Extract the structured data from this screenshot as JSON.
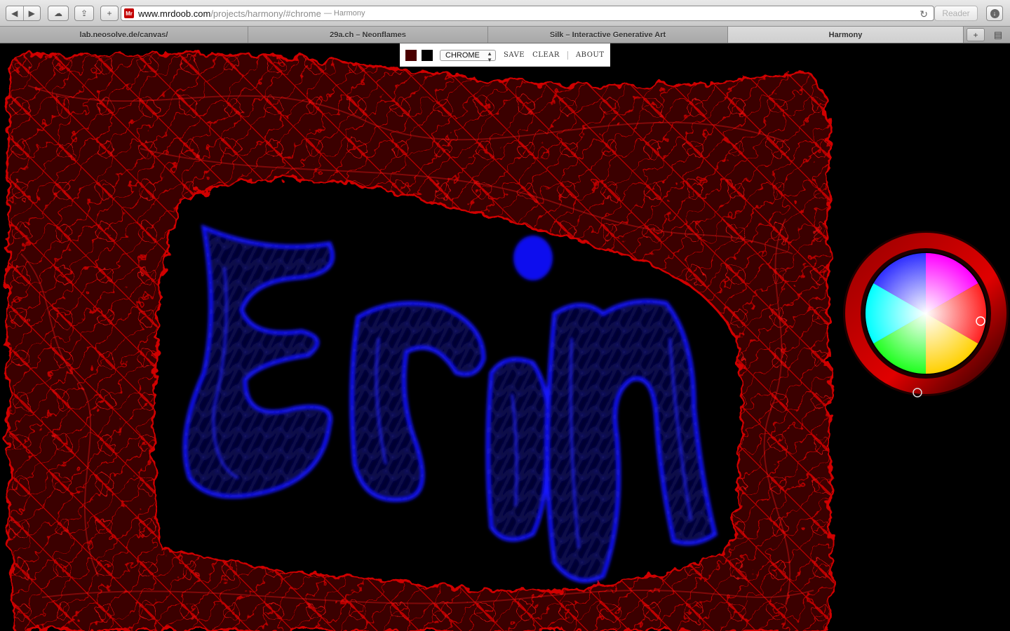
{
  "browser": {
    "url_host": "www.mrdoob.com",
    "url_path": "/projects/harmony/#chrome",
    "url_title": "— Harmony",
    "favicon_text": "Mr",
    "reader_label": "Reader"
  },
  "tabs": [
    {
      "label": "lab.neosolve.de/canvas/"
    },
    {
      "label": "29a.ch – Neonflames"
    },
    {
      "label": "Silk – Interactive Generative Art"
    },
    {
      "label": "Harmony"
    }
  ],
  "harmony_menu": {
    "foreground_color": "#4a0000",
    "background_color": "#000000",
    "brush": "CHROME",
    "save_label": "SAVE",
    "clear_label": "CLEAR",
    "about_label": "ABOUT"
  },
  "artwork": {
    "frame_color": "#b00000",
    "text_color": "#1010ff",
    "drawn_text": "Erin"
  },
  "color_picker": {
    "ring_color": "#d40000"
  }
}
